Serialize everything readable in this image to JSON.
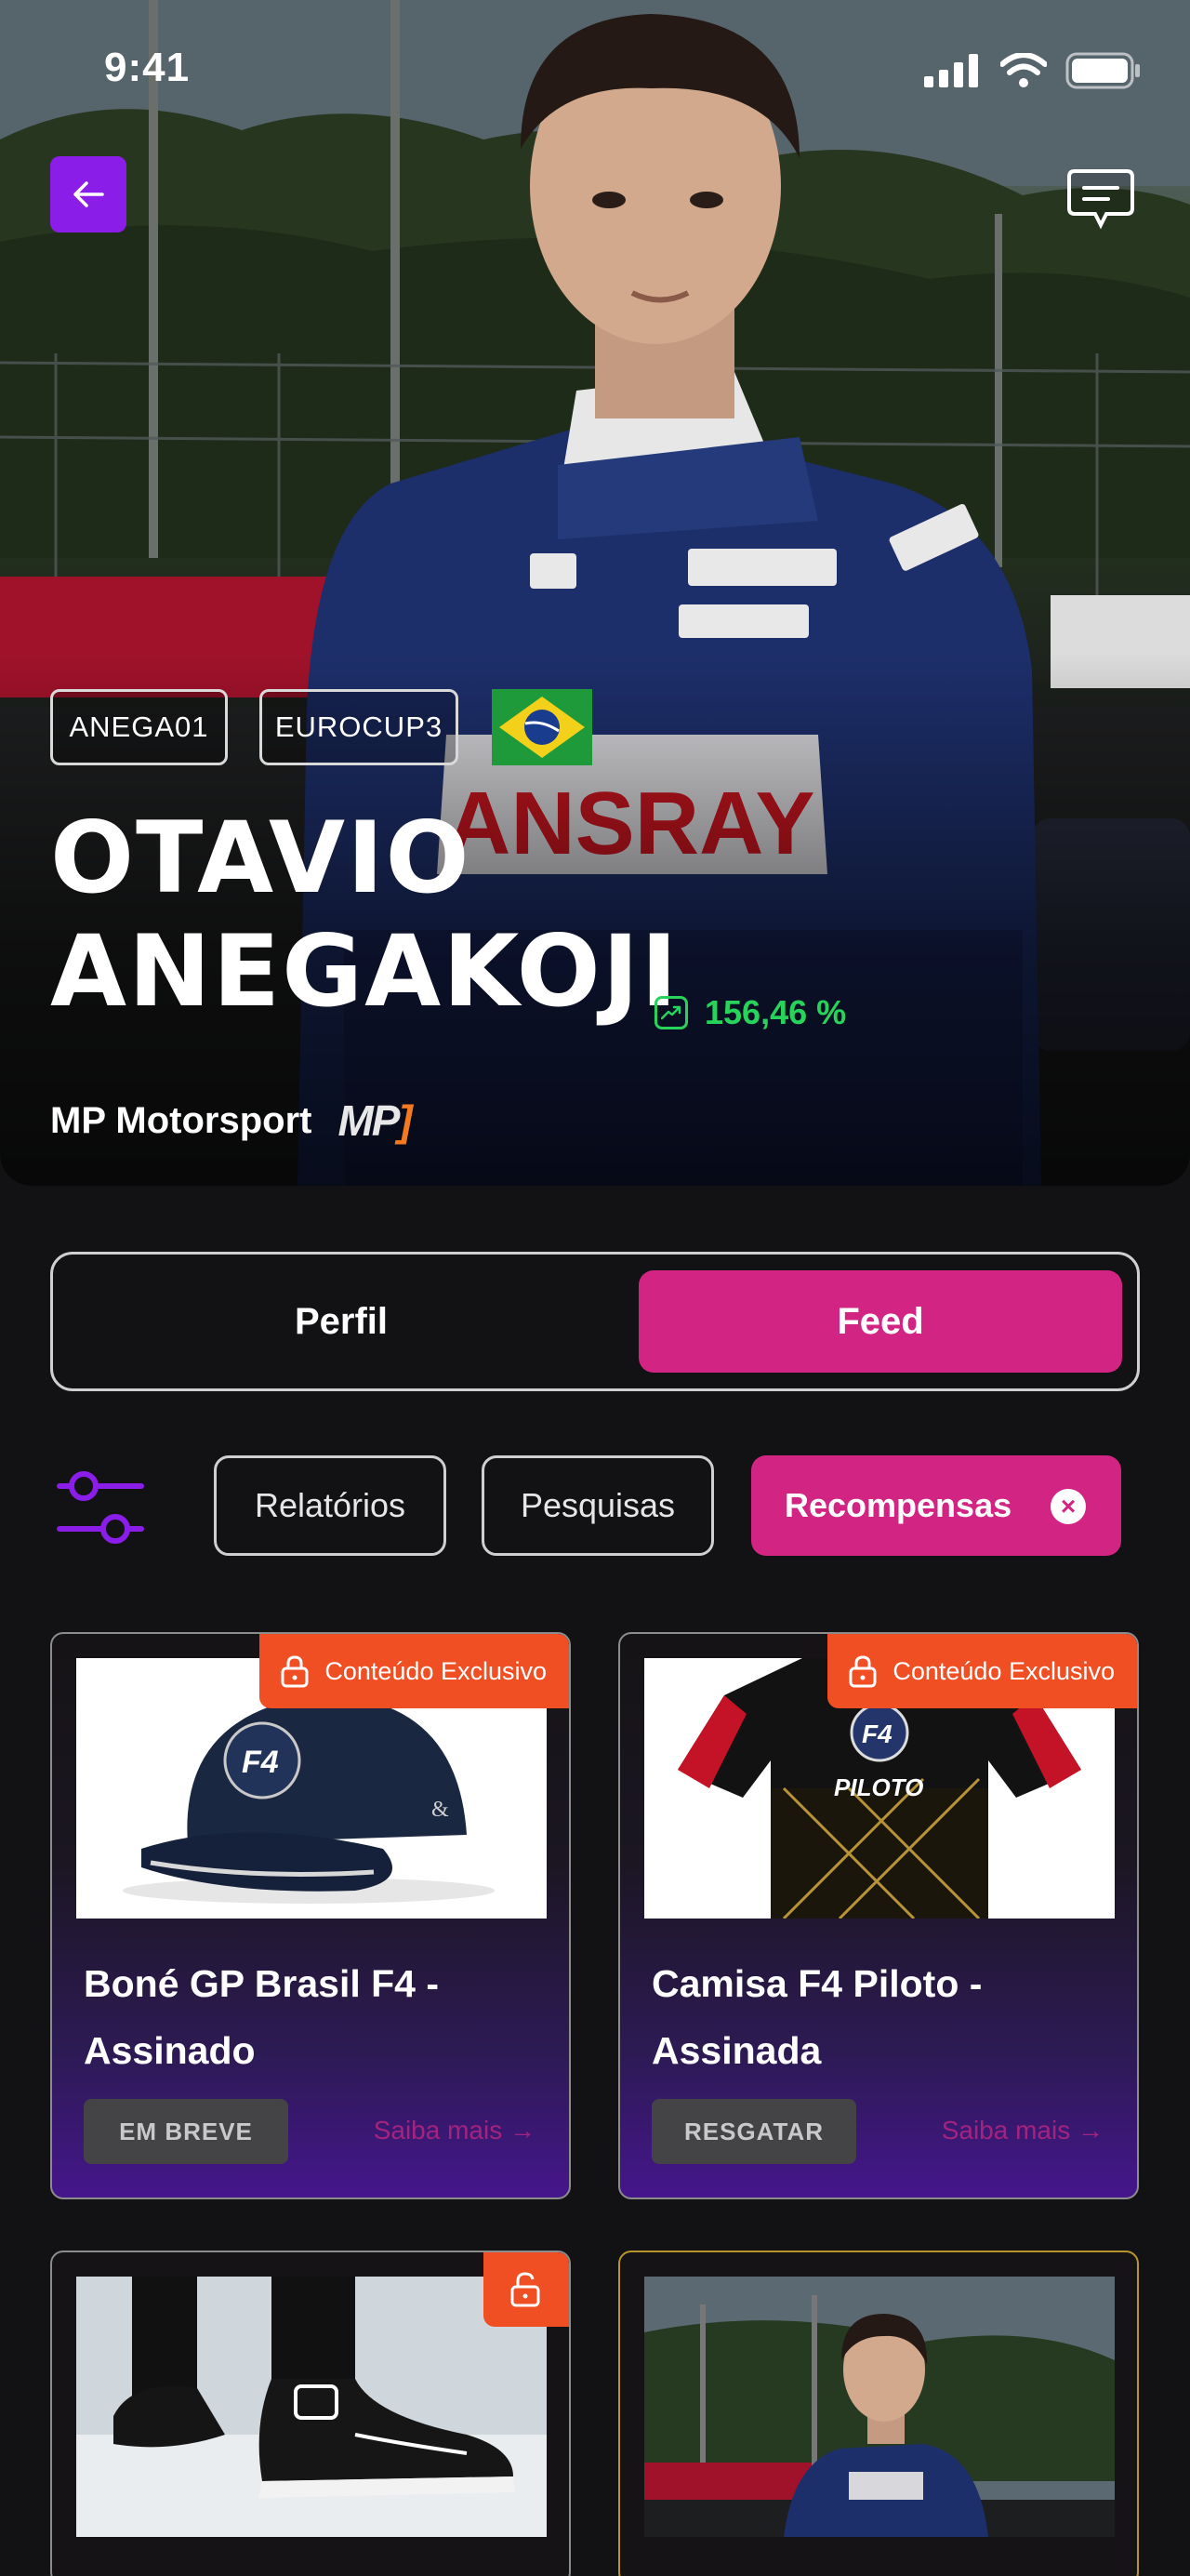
{
  "status_bar": {
    "time": "9:41"
  },
  "header": {
    "back_icon": "arrow-left-icon",
    "chat_icon": "chat-bubble-icon"
  },
  "driver": {
    "tags": [
      "ANEGA01",
      "EUROCUP3"
    ],
    "nationality_flag": "brazil-flag",
    "first_name": "OTAVIO",
    "last_name": "ANEGAKOJI",
    "growth": "156,46 %",
    "growth_color": "#27d35a",
    "team": "MP Motorsport",
    "team_logo_main": "MP",
    "team_logo_accent": "]"
  },
  "tabs": [
    {
      "label": "Perfil",
      "active": false
    },
    {
      "label": "Feed",
      "active": true
    }
  ],
  "filters": {
    "icon": "sliders-icon",
    "chips": [
      {
        "label": "Relatórios",
        "active": false
      },
      {
        "label": "Pesquisas",
        "active": false
      },
      {
        "label": "Recompensas",
        "active": true,
        "close_icon": "×"
      }
    ]
  },
  "colors": {
    "accent": "#d22583",
    "purple": "#8a1ee8",
    "badge": "#f04e23"
  },
  "cards": [
    {
      "badge": "Conteúdo Exclusivo",
      "title": "Boné GP Brasil F4 - Assinado",
      "button": "EM BREVE",
      "link": "Saiba mais →",
      "image": "cap"
    },
    {
      "badge": "Conteúdo Exclusivo",
      "title": "Camisa F4 Piloto - Assinada",
      "button": "RESGATAR",
      "link": "Saiba mais →",
      "image": "shirt"
    },
    {
      "badge": "",
      "title": "",
      "button": "",
      "link": "",
      "image": "shoes",
      "lock_icon": "unlock-icon"
    },
    {
      "badge": "",
      "title": "",
      "button": "",
      "link": "",
      "image": "driver-photo"
    }
  ],
  "product_art": {
    "cap_logo": "F4",
    "shirt_logo": "F4",
    "shirt_text": "PILOTO",
    "suit_brand": "ANSRAY"
  }
}
